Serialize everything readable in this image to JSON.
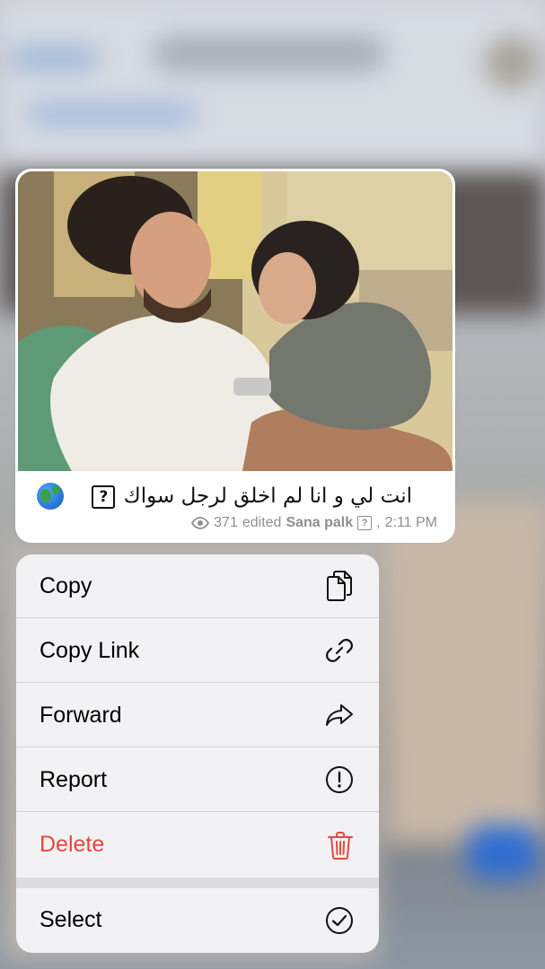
{
  "message": {
    "caption_text": "انت لي و انا لم اخلق لرجل سواك",
    "caption_box_char": "?",
    "views": "371",
    "edited_label": "edited",
    "author": "Sana palk",
    "author_box_char": "?",
    "time": "2:11 PM",
    "icons": {
      "photo": "couple-photo",
      "globe": "globe-emoji-icon",
      "views": "eye-icon"
    }
  },
  "menu": {
    "items": [
      {
        "label": "Copy",
        "icon": "copy-icon"
      },
      {
        "label": "Copy Link",
        "icon": "link-icon"
      },
      {
        "label": "Forward",
        "icon": "forward-arrow-icon"
      },
      {
        "label": "Report",
        "icon": "exclamation-circle-icon"
      },
      {
        "label": "Delete",
        "icon": "trash-icon",
        "color": "#e8463f"
      },
      {
        "label": "Select",
        "icon": "checkmark-circle-icon"
      }
    ]
  },
  "colors": {
    "danger": "#e8463f",
    "meta_text": "#8e8e93",
    "menu_bg": "#f5f5f7"
  }
}
